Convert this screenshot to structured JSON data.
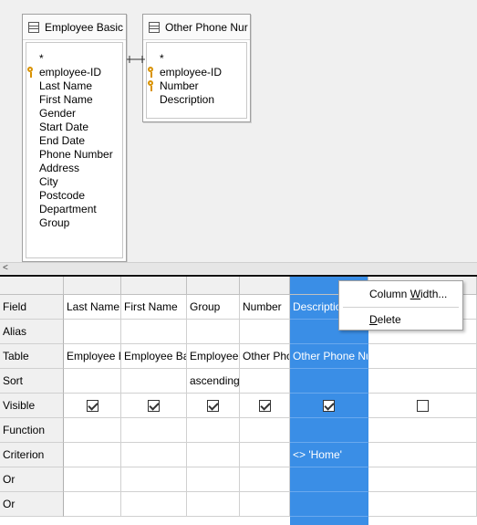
{
  "tables": [
    {
      "title": "Employee Basic D",
      "fields": [
        "*",
        "employee-ID",
        "Last Name",
        "First Name",
        "Gender",
        "Start Date",
        "End Date",
        "Phone Number",
        "Address",
        "City",
        "Postcode",
        "Department",
        "Group"
      ],
      "key_fields": [
        "employee-ID"
      ]
    },
    {
      "title": "Other Phone Nur",
      "fields": [
        "*",
        "employee-ID",
        "Number",
        "Description"
      ],
      "key_fields": [
        "employee-ID",
        "Number"
      ]
    }
  ],
  "scroll": {
    "left_arrow": "<"
  },
  "grid": {
    "row_headers": [
      "Field",
      "Alias",
      "Table",
      "Sort",
      "Visible",
      "Function",
      "Criterion",
      "Or",
      "Or"
    ],
    "columns": [
      {
        "field": "Last Name",
        "alias": "",
        "table": "Employee B",
        "sort": "",
        "visible": true,
        "function": "",
        "criterion": "",
        "or1": "",
        "or2": ""
      },
      {
        "field": "First Name",
        "alias": "",
        "table": "Employee Ba",
        "sort": "",
        "visible": true,
        "function": "",
        "criterion": "",
        "or1": "",
        "or2": ""
      },
      {
        "field": "Group",
        "alias": "",
        "table": "Employee",
        "sort": "ascending",
        "visible": true,
        "function": "",
        "criterion": "",
        "or1": "",
        "or2": ""
      },
      {
        "field": "Number",
        "alias": "",
        "table": "Other Phc",
        "sort": "",
        "visible": true,
        "function": "",
        "criterion": "",
        "or1": "",
        "or2": ""
      },
      {
        "field": "Descriptio",
        "alias": "",
        "table": "Other Phone Nu",
        "sort": "",
        "visible": true,
        "function": "",
        "criterion": "<> 'Home'",
        "or1": "",
        "or2": ""
      },
      {
        "field": "",
        "alias": "",
        "table": "",
        "sort": "",
        "visible": false,
        "function": "",
        "criterion": "",
        "or1": "",
        "or2": ""
      }
    ],
    "selected_column_index": 4,
    "selection_color": "#3a8ee6"
  },
  "context_menu": {
    "items": [
      {
        "label": "Column Width...",
        "mnemonic": "W"
      },
      {
        "label": "Delete",
        "mnemonic": "D"
      }
    ]
  },
  "icons": {
    "table": "table-icon",
    "primary_key": "key-icon",
    "checkbox": "checkbox-icon"
  }
}
